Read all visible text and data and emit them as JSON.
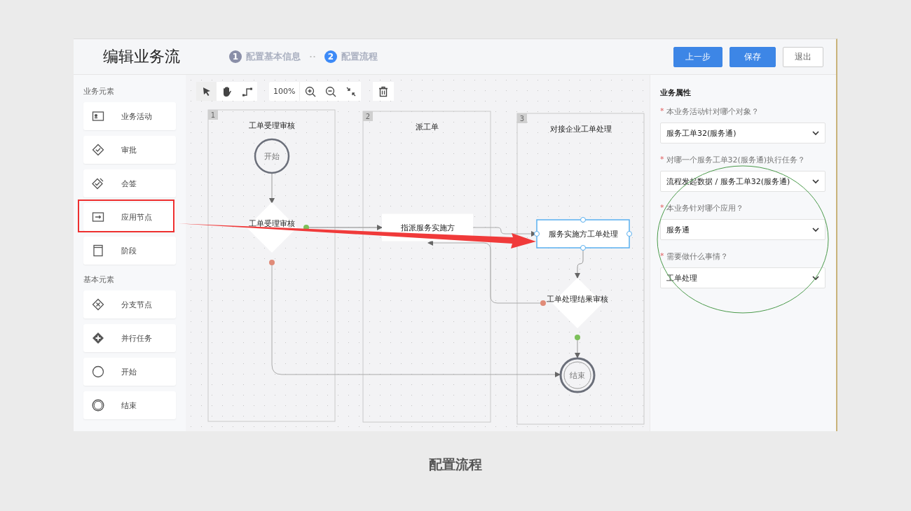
{
  "header": {
    "title": "编辑业务流",
    "steps": [
      {
        "number": "1",
        "label": "配置基本信息",
        "selected": false
      },
      {
        "number": "2",
        "label": "配置流程",
        "selected": true
      }
    ],
    "buttons": [
      {
        "label": "上一步",
        "kind": "primary"
      },
      {
        "label": "保存",
        "kind": "primary"
      },
      {
        "label": "退出",
        "kind": "default"
      }
    ]
  },
  "palette": {
    "sections": [
      {
        "title": "业务元素",
        "items": [
          {
            "label": "业务活动",
            "kind": "activity"
          },
          {
            "label": "审批",
            "kind": "approval"
          },
          {
            "label": "会签",
            "kind": "countersign"
          },
          {
            "label": "应用节点",
            "kind": "app-node"
          },
          {
            "label": "阶段",
            "kind": "stage"
          }
        ]
      },
      {
        "title": "基本元素",
        "items": [
          {
            "label": "分支节点",
            "kind": "branch"
          },
          {
            "label": "并行任务",
            "kind": "parallel"
          },
          {
            "label": "开始",
            "kind": "start"
          },
          {
            "label": "结束",
            "kind": "end"
          }
        ]
      }
    ]
  },
  "toolbar": {
    "tools": [
      {
        "kind": "pointer",
        "selected": true
      },
      {
        "kind": "hand",
        "selected": false
      },
      {
        "kind": "connector",
        "selected": false
      }
    ],
    "zoom": "100%"
  },
  "canvas": {
    "lanes": [
      {
        "number": "1",
        "title": "工单受理审核"
      },
      {
        "number": "2",
        "title": "派工单"
      },
      {
        "number": "3",
        "title": "对接企业工单处理"
      }
    ],
    "nodes": [
      {
        "kind": "start",
        "label": "开始",
        "selected": false
      },
      {
        "kind": "gateway",
        "label": "工单受理审核",
        "selected": false
      },
      {
        "kind": "task",
        "label": "指派服务实施方",
        "selected": false
      },
      {
        "kind": "task",
        "label": "服务实施方工单处理",
        "selected": true
      },
      {
        "kind": "gateway",
        "label": "工单处理结果审核",
        "selected": false
      },
      {
        "kind": "end",
        "label": "结束",
        "selected": false
      }
    ]
  },
  "properties": {
    "title": "业务属性",
    "fields": [
      {
        "label": "本业务活动针对哪个对象？",
        "required_mark": "*",
        "value": "服务工单32(服务通)"
      },
      {
        "label": "对哪一个服务工单32(服务通)执行任务？",
        "required_mark": "*",
        "value": "流程发起数据 / 服务工单32(服务通)"
      },
      {
        "label": "本业务针对哪个应用？",
        "required_mark": "*",
        "value": "服务通"
      },
      {
        "label": "需要做什么事情？",
        "required_mark": "*",
        "value": "工单处理"
      }
    ]
  },
  "caption": "配置流程"
}
